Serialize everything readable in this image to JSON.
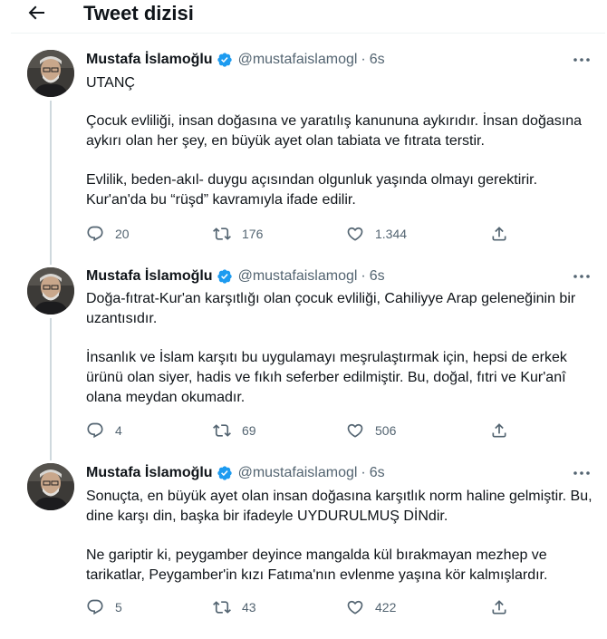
{
  "header": {
    "title": "Tweet dizisi",
    "back_icon": "arrow-left-icon"
  },
  "colors": {
    "verified": "#1d9bf0",
    "icon": "#536471",
    "text": "#0f1419",
    "secondary": "#536471"
  },
  "tweets": [
    {
      "name": "Mustafa İslamoğlu",
      "handle": "@mustafaislamogl",
      "separator": "·",
      "time": "6s",
      "paragraphs": [
        "UTANÇ",
        "Çocuk evliliği, insan doğasına ve yaratılış kanununa aykırıdır. İnsan doğasına aykırı olan her şey, en büyük ayet olan tabiata ve fıtrata terstir.",
        "Evlilik, beden-akıl- duygu açısından olgunluk yaşında olmayı gerektirir. Kur'an'da bu “rüşd” kavramıyla ifade edilir."
      ],
      "replies": "20",
      "retweets": "176",
      "likes": "1.344"
    },
    {
      "name": "Mustafa İslamoğlu",
      "handle": "@mustafaislamogl",
      "separator": "·",
      "time": "6s",
      "paragraphs": [
        "Doğa-fıtrat-Kur'an karşıtlığı olan çocuk evliliği, Cahiliyye Arap geleneğinin bir uzantısıdır.",
        "İnsanlık ve İslam karşıtı bu uygulamayı meşrulaştırmak için, hepsi de erkek ürünü olan siyer, hadis ve fıkıh seferber edilmiştir. Bu, doğal, fıtri ve Kur'anî olana meydan okumadır."
      ],
      "replies": "4",
      "retweets": "69",
      "likes": "506"
    },
    {
      "name": "Mustafa İslamoğlu",
      "handle": "@mustafaislamogl",
      "separator": "·",
      "time": "6s",
      "paragraphs": [
        "Sonuçta, en büyük ayet olan insan doğasına karşıtlık norm haline gelmiştir. Bu, dine karşı din, başka bir ifadeyle UYDURULMUŞ DİNdir.",
        "Ne gariptir ki, peygamber deyince mangalda kül bırakmayan mezhep ve tarikatlar, Peygamber'in kızı Fatıma'nın evlenme yaşına kör kalmışlardır."
      ],
      "replies": "5",
      "retweets": "43",
      "likes": "422"
    }
  ]
}
